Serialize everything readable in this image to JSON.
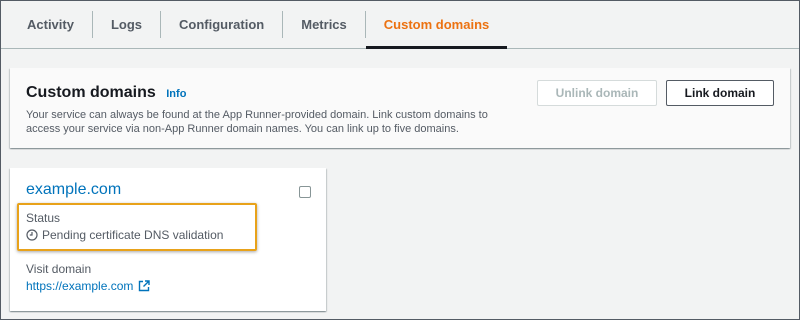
{
  "tabs": [
    {
      "label": "Activity"
    },
    {
      "label": "Logs"
    },
    {
      "label": "Configuration"
    },
    {
      "label": "Metrics"
    },
    {
      "label": "Custom domains",
      "active": true
    }
  ],
  "panel": {
    "title": "Custom domains",
    "info": "Info",
    "description": "Your service can always be found at the App Runner-provided domain. Link custom domains to access your service via non-App Runner domain names. You can link up to five domains.",
    "unlink_label": "Unlink domain",
    "link_label": "Link domain"
  },
  "card": {
    "title": "example.com",
    "status_label": "Status",
    "status_value": "Pending certificate DNS validation",
    "status_icon": "clock-icon",
    "visit_label": "Visit domain",
    "visit_link": "https://example.com",
    "visit_icon": "external-link-icon"
  },
  "colors": {
    "accent": "#ec7211",
    "link": "#0073bb",
    "highlight": "#e8a21a"
  }
}
